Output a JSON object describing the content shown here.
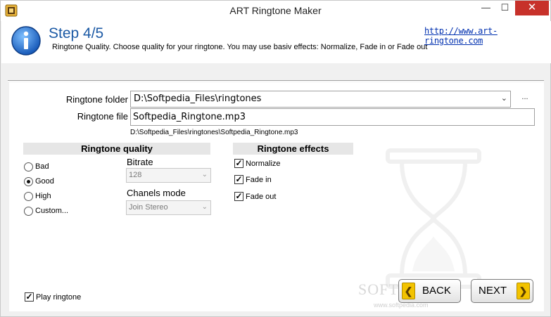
{
  "window": {
    "title": "ART Ringtone Maker",
    "minimize_glyph": "—",
    "maximize_glyph": "☐",
    "close_glyph": "✕"
  },
  "header": {
    "step": "Step 4/5",
    "description": "Ringtone Quality. Choose quality for your ringtone.  You may use basiv effects: Normalize, Fade in or Fade out",
    "link": "http://www.art-ringtone.com"
  },
  "form": {
    "folder_label": "Ringtone folder",
    "folder_value": "D:\\Softpedia_Files\\ringtones",
    "browse_label": "...",
    "file_label": "Ringtone file",
    "file_value": "Softpedia_Ringtone.mp3",
    "full_path": "D:\\Softpedia_Files\\ringtones\\Softpedia_Ringtone.mp3"
  },
  "quality": {
    "heading": "Ringtone quality",
    "options": [
      {
        "label": "Bad",
        "checked": false
      },
      {
        "label": "Good",
        "checked": true
      },
      {
        "label": "High",
        "checked": false
      },
      {
        "label": "Custom...",
        "checked": false
      }
    ],
    "bitrate_label": "Bitrate",
    "bitrate_value": "128",
    "channels_label": "Chanels mode",
    "channels_value": "Join Stereo"
  },
  "effects": {
    "heading": "Ringtone effects",
    "items": [
      {
        "label": "Normalize",
        "checked": true
      },
      {
        "label": "Fade in",
        "checked": true
      },
      {
        "label": "Fade out",
        "checked": true
      }
    ]
  },
  "footer": {
    "play_label": "Play ringtone",
    "play_checked": true,
    "back_label": "BACK",
    "next_label": "NEXT",
    "watermark": "SOFTPEDIA",
    "watermark_sub": "www.softpedia.com"
  },
  "colors": {
    "accent_title": "#1c5aa5",
    "link": "#0030b0",
    "close_button": "#c7312a",
    "nav_arrow": "#f3c300"
  },
  "icons": {
    "app": "app-icon",
    "info": "info-icon",
    "back_arrow": "chevron-left-icon",
    "next_arrow": "chevron-right-icon"
  }
}
